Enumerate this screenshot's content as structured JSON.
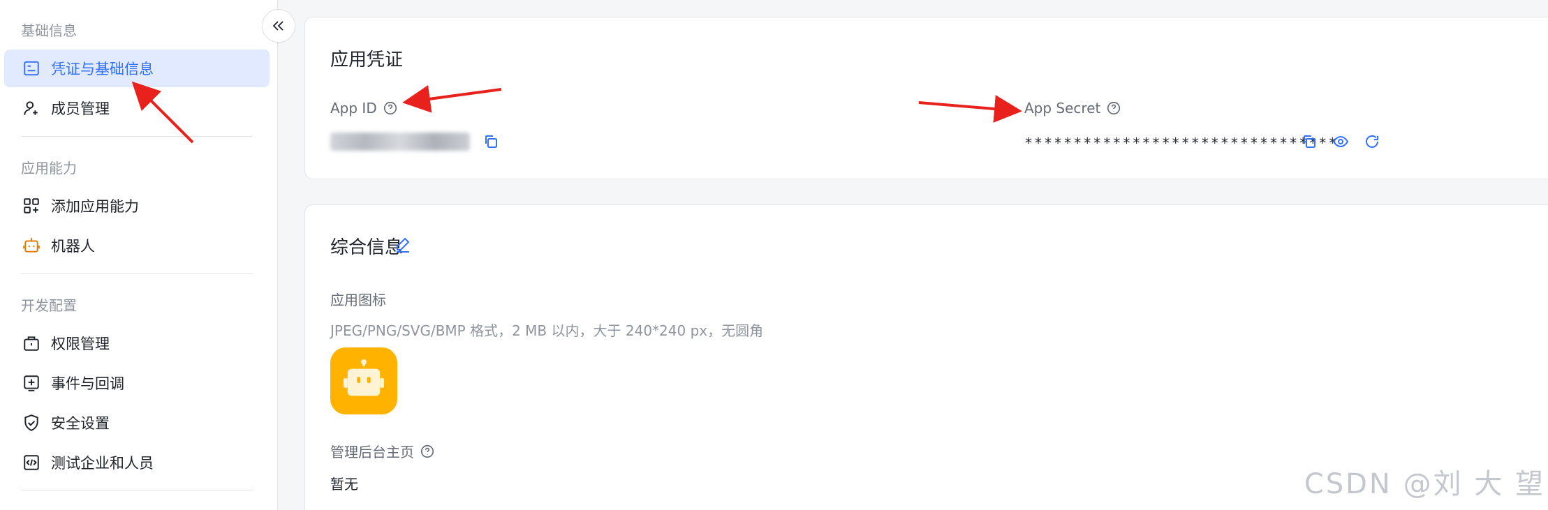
{
  "sidebar": {
    "groups": [
      {
        "title": "基础信息",
        "items": [
          {
            "label": "凭证与基础信息",
            "icon": "credential-icon",
            "active": true
          },
          {
            "label": "成员管理",
            "icon": "add-member-icon",
            "active": false
          }
        ]
      },
      {
        "title": "应用能力",
        "items": [
          {
            "label": "添加应用能力",
            "icon": "grid-plus-icon",
            "active": false
          },
          {
            "label": "机器人",
            "icon": "robot-icon",
            "active": false
          }
        ]
      },
      {
        "title": "开发配置",
        "items": [
          {
            "label": "权限管理",
            "icon": "permission-icon",
            "active": false
          },
          {
            "label": "事件与回调",
            "icon": "event-icon",
            "active": false
          },
          {
            "label": "安全设置",
            "icon": "shield-icon",
            "active": false
          },
          {
            "label": "测试企业和人员",
            "icon": "code-icon",
            "active": false
          }
        ]
      }
    ]
  },
  "credentials": {
    "title": "应用凭证",
    "app_id_label": "App ID",
    "app_secret_label": "App Secret",
    "app_secret_value": "********************************"
  },
  "general": {
    "title": "综合信息",
    "icon_label": "应用图标",
    "icon_hint": "JPEG/PNG/SVG/BMP 格式，2 MB 以内，大于 240*240 px，无圆角",
    "homepage_label": "管理后台主页",
    "homepage_value": "暂无"
  },
  "watermark": "CSDN @刘 大 望",
  "colors": {
    "accent": "#3370ff",
    "active_bg": "#e1eaff",
    "app_icon_bg": "#ffb300",
    "annotation_arrow": "#e8211c"
  }
}
